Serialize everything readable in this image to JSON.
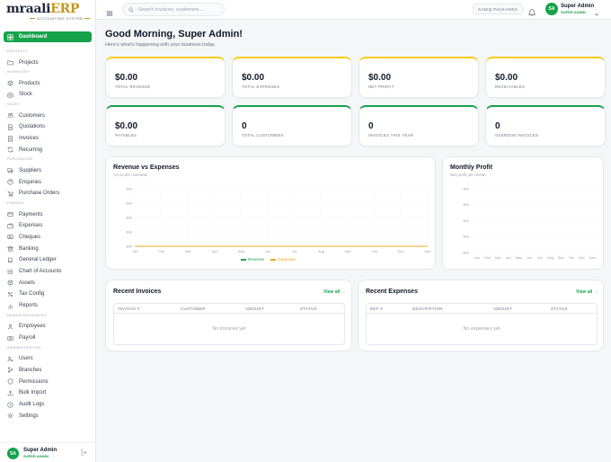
{
  "brand": {
    "name_a": "mraali",
    "name_b": "ERP",
    "tagline": "ACCOUNTING SYSTEM"
  },
  "sidebar": {
    "items": [
      {
        "label": "Dashboard",
        "icon": "grid-icon",
        "active": true
      },
      {
        "section": "PROJECTS"
      },
      {
        "label": "Projects",
        "icon": "folder-icon"
      },
      {
        "section": "INVENTORY"
      },
      {
        "label": "Products",
        "icon": "box-icon"
      },
      {
        "label": "Stock",
        "icon": "warehouse-icon"
      },
      {
        "section": "SALES"
      },
      {
        "label": "Customers",
        "icon": "users-icon"
      },
      {
        "label": "Quotations",
        "icon": "document-icon"
      },
      {
        "label": "Invoices",
        "icon": "receipt-icon"
      },
      {
        "label": "Recurring",
        "icon": "refresh-icon"
      },
      {
        "section": "PURCHASING"
      },
      {
        "label": "Suppliers",
        "icon": "truck-icon"
      },
      {
        "label": "Enquiries",
        "icon": "question-icon"
      },
      {
        "label": "Purchase Orders",
        "icon": "cart-icon"
      },
      {
        "section": "FINANCE"
      },
      {
        "label": "Payments",
        "icon": "card-icon"
      },
      {
        "label": "Expenses",
        "icon": "wallet-icon"
      },
      {
        "label": "Cheques",
        "icon": "cheque-icon"
      },
      {
        "label": "Banking",
        "icon": "bank-icon"
      },
      {
        "label": "General Ledger",
        "icon": "book-icon"
      },
      {
        "label": "Chart of Accounts",
        "icon": "list-icon"
      },
      {
        "label": "Assets",
        "icon": "cube-icon"
      },
      {
        "label": "Tax Config",
        "icon": "percent-icon"
      },
      {
        "label": "Reports",
        "icon": "chart-icon"
      },
      {
        "section": "HUMAN RESOURCES"
      },
      {
        "label": "Employees",
        "icon": "user-group-icon"
      },
      {
        "label": "Payroll",
        "icon": "money-icon"
      },
      {
        "section": "ADMINISTRATION"
      },
      {
        "label": "Users",
        "icon": "user-cog-icon"
      },
      {
        "label": "Branches",
        "icon": "branch-icon"
      },
      {
        "label": "Permissions",
        "icon": "shield-icon"
      },
      {
        "label": "Bulk Import",
        "icon": "upload-icon"
      },
      {
        "label": "Audit Logs",
        "icon": "clock-icon"
      },
      {
        "label": "Settings",
        "icon": "gear-icon"
      }
    ]
  },
  "user": {
    "initials": "SA",
    "name": "Super Admin",
    "role": "SUPER ADMIN"
  },
  "header": {
    "search_placeholder": "Search invoices, customers...",
    "branch": "SADIQ PACKAGES"
  },
  "greeting": {
    "title": "Good Morning, Super Admin!",
    "subtitle": "Here's what's happening with your business today."
  },
  "stats": [
    {
      "value": "$0.00",
      "label": "TOTAL REVENUE",
      "accent": "#facc15"
    },
    {
      "value": "$0.00",
      "label": "TOTAL EXPENSES",
      "accent": "#facc15"
    },
    {
      "value": "$0.00",
      "label": "NET PROFIT",
      "accent": "#facc15"
    },
    {
      "value": "$0.00",
      "label": "RECEIVABLES",
      "accent": "#facc15"
    },
    {
      "value": "$0.00",
      "label": "PAYABLES",
      "accent": "#16a34a"
    },
    {
      "value": "0",
      "label": "TOTAL CUSTOMERS",
      "accent": "#16a34a"
    },
    {
      "value": "0",
      "label": "INVOICES THIS YEAR",
      "accent": "#16a34a"
    },
    {
      "value": "0",
      "label": "OVERDUE INVOICES",
      "accent": "#16a34a"
    }
  ],
  "chart_data": [
    {
      "type": "line",
      "title": "Revenue vs Expenses",
      "subtitle": "12-month overview",
      "categories": [
        "Jan",
        "Feb",
        "Mar",
        "Apr",
        "May",
        "Jun",
        "Jul",
        "Aug",
        "Sep",
        "Oct",
        "Nov",
        "Dec"
      ],
      "yticks": [
        "$0k",
        "$0k",
        "$0k",
        "$0k",
        "$0k"
      ],
      "ylim": [
        0,
        1
      ],
      "series": [
        {
          "name": "Revenue",
          "color": "#16a34a",
          "values": [
            0,
            0,
            0,
            0,
            0,
            0,
            0,
            0,
            0,
            0,
            0,
            0
          ]
        },
        {
          "name": "Expenses",
          "color": "#e5a823",
          "values": [
            0,
            0,
            0,
            0,
            0,
            0,
            0,
            0,
            0,
            0,
            0,
            0
          ]
        }
      ],
      "legend": "bottom",
      "grid": true
    },
    {
      "type": "bar",
      "title": "Monthly Profit",
      "subtitle": "Net profit per month",
      "categories": [
        "Jan",
        "Feb",
        "Mar",
        "Apr",
        "May",
        "Jun",
        "Jul",
        "Aug",
        "Sep",
        "Oct",
        "Nov",
        "Dec"
      ],
      "yticks": [
        "$0k",
        "$0k",
        "$0k",
        "$0k",
        "$0k"
      ],
      "ylim": [
        0,
        1
      ],
      "values": [
        0,
        0,
        0,
        0,
        0,
        0,
        0,
        0,
        0,
        0,
        0,
        0
      ],
      "grid": true
    }
  ],
  "recent_invoices": {
    "title": "Recent Invoices",
    "view_all": "View all →",
    "columns": [
      "INVOICE #",
      "CUSTOMER",
      "AMOUNT",
      "STATUS"
    ],
    "empty": "No invoices yet"
  },
  "recent_expenses": {
    "title": "Recent Expenses",
    "view_all": "View all →",
    "columns": [
      "REF #",
      "DESCRIPTION",
      "AMOUNT",
      "STATUS"
    ],
    "empty": "No expenses yet"
  }
}
